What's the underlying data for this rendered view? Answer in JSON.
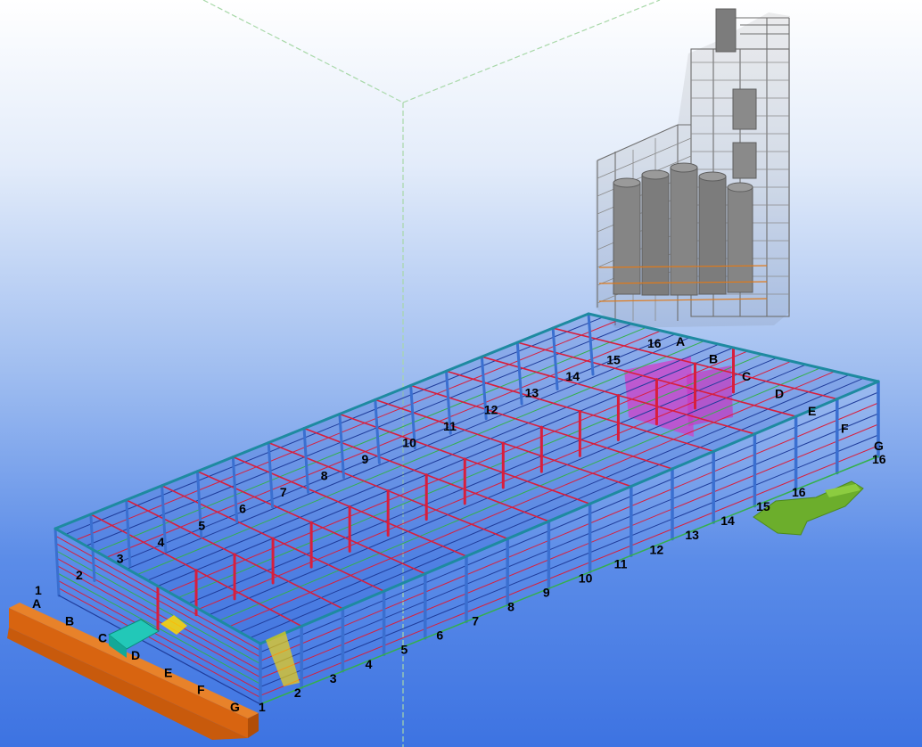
{
  "viewer": {
    "background_top": "#ffffff",
    "background_bottom": "#3d73e2"
  },
  "grid_labels": {
    "front_letters": [
      "A",
      "B",
      "C",
      "D",
      "E",
      "F",
      "G"
    ],
    "front_numbers": [
      "1",
      "2",
      "3",
      "4",
      "5",
      "6",
      "7",
      "8",
      "9",
      "10",
      "11",
      "12",
      "13",
      "14",
      "15",
      "16"
    ],
    "roof_numbers": [
      "2",
      "3",
      "4",
      "5",
      "6",
      "7",
      "8",
      "9",
      "10",
      "11",
      "12",
      "13",
      "14",
      "15",
      "16"
    ],
    "back_letters": [
      "A",
      "B",
      "C",
      "D",
      "E",
      "F",
      "G"
    ],
    "left_end_number": "1",
    "right_end_number": "16"
  },
  "colors": {
    "column": "#3a6fd0",
    "rafter": "#d81e3c",
    "purlin_green": "#34b04a",
    "roof_edge": "#1e8aa0",
    "silo_structure": "#6e6e6e",
    "concrete_orange": "#d86410",
    "slab_green": "#6cae2c",
    "cladding_magenta": "#d040c8"
  }
}
